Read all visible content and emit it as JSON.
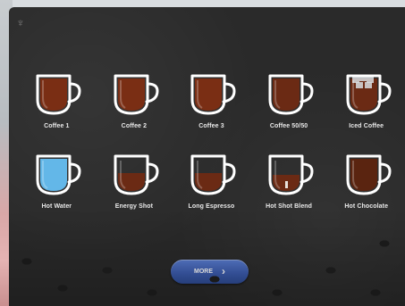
{
  "drinks": [
    {
      "label": "Coffee 1",
      "fill": "full",
      "color": "#7a2e14"
    },
    {
      "label": "Coffee 2",
      "fill": "full",
      "color": "#7a2e14"
    },
    {
      "label": "Coffee 3",
      "fill": "full",
      "color": "#7a2e14"
    },
    {
      "label": "Coffee 50/50",
      "fill": "full",
      "color": "#6b2a14"
    },
    {
      "label": "Iced Coffee",
      "fill": "iced",
      "color": "#6b2a14"
    },
    {
      "label": "Hot Water",
      "fill": "water",
      "color": "#63b7e8"
    },
    {
      "label": "Energy Shot",
      "fill": "half",
      "color": "#6b2a14"
    },
    {
      "label": "Long Espresso",
      "fill": "half",
      "color": "#6b2a14"
    },
    {
      "label": "Hot Shot Blend",
      "fill": "blend",
      "color": "#6b2a14"
    },
    {
      "label": "Hot Chocolate",
      "fill": "full",
      "color": "#5a2410"
    }
  ],
  "more_button": {
    "label": "MORE",
    "chevron": "›"
  },
  "colors": {
    "accent": "#3e5fb3",
    "background": "#2a2a2a",
    "cup_outline": "#ffffff"
  }
}
